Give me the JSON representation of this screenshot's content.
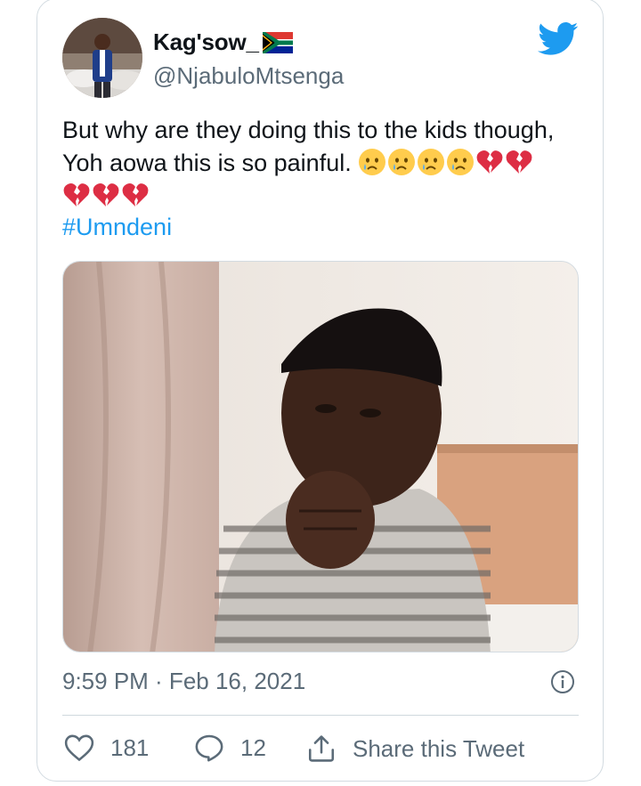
{
  "tweet": {
    "author": {
      "display_name": "Kag'sow_",
      "flag_icon": "south-africa-flag-icon",
      "handle": "@NjabuloMtsenga",
      "avatar_icon": "profile-photo"
    },
    "brand_icon": "twitter-bird-icon",
    "brand_color": "#1d9bf0",
    "text_line1": "But why are they doing this to the kids though,",
    "text_line2": "Yoh aowa this is so painful.",
    "emojis": [
      "crying-face",
      "crying-face",
      "crying-face",
      "crying-face",
      "broken-heart",
      "broken-heart",
      "broken-heart",
      "broken-heart",
      "broken-heart"
    ],
    "hashtag": "#Umndeni",
    "media": {
      "type": "photo",
      "description_icon": "child-praying-photo"
    },
    "timestamp": "9:59 PM · Feb 16, 2021",
    "actions": {
      "likes": "181",
      "replies": "12",
      "share_label": "Share this Tweet"
    }
  }
}
